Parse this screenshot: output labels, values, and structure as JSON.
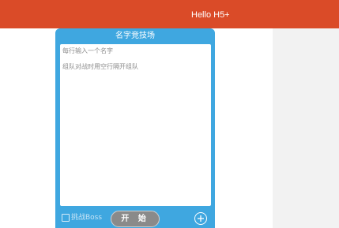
{
  "header": {
    "title": "Hello H5+",
    "color": "#da4b28"
  },
  "panel": {
    "title": "名字竞技场",
    "color": "#3fa7e0",
    "input_hint_line1": "每行输入一个名字",
    "input_hint_line2": "组队对战时用空行隔开组队",
    "boss_checkbox_label": "挑战Boss",
    "boss_checked": false,
    "start_label": "开 始",
    "add_icon": "plus-circle-icon"
  }
}
